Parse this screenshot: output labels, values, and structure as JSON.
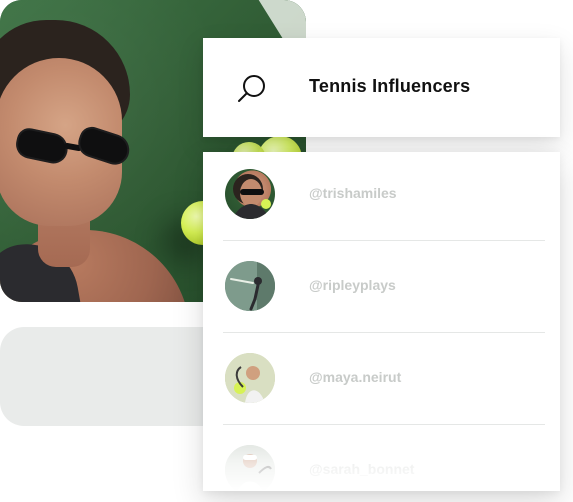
{
  "search": {
    "title": "Tennis Influencers",
    "icon": "search-icon"
  },
  "results": {
    "items": [
      {
        "handle": "@trishamiles",
        "avatar": "avatar-trishamiles"
      },
      {
        "handle": "@ripleyplays",
        "avatar": "avatar-ripleyplays"
      },
      {
        "handle": "@maya.neirut",
        "avatar": "avatar-maya-neirut"
      },
      {
        "handle": "@sarah_bonnet",
        "avatar": "avatar-sarah-bonnet"
      }
    ]
  },
  "colors": {
    "title_text": "#111111",
    "handle_text": "#c8cbc9",
    "placeholder_bg": "#e9ebea",
    "divider": "#e5e7e6"
  }
}
